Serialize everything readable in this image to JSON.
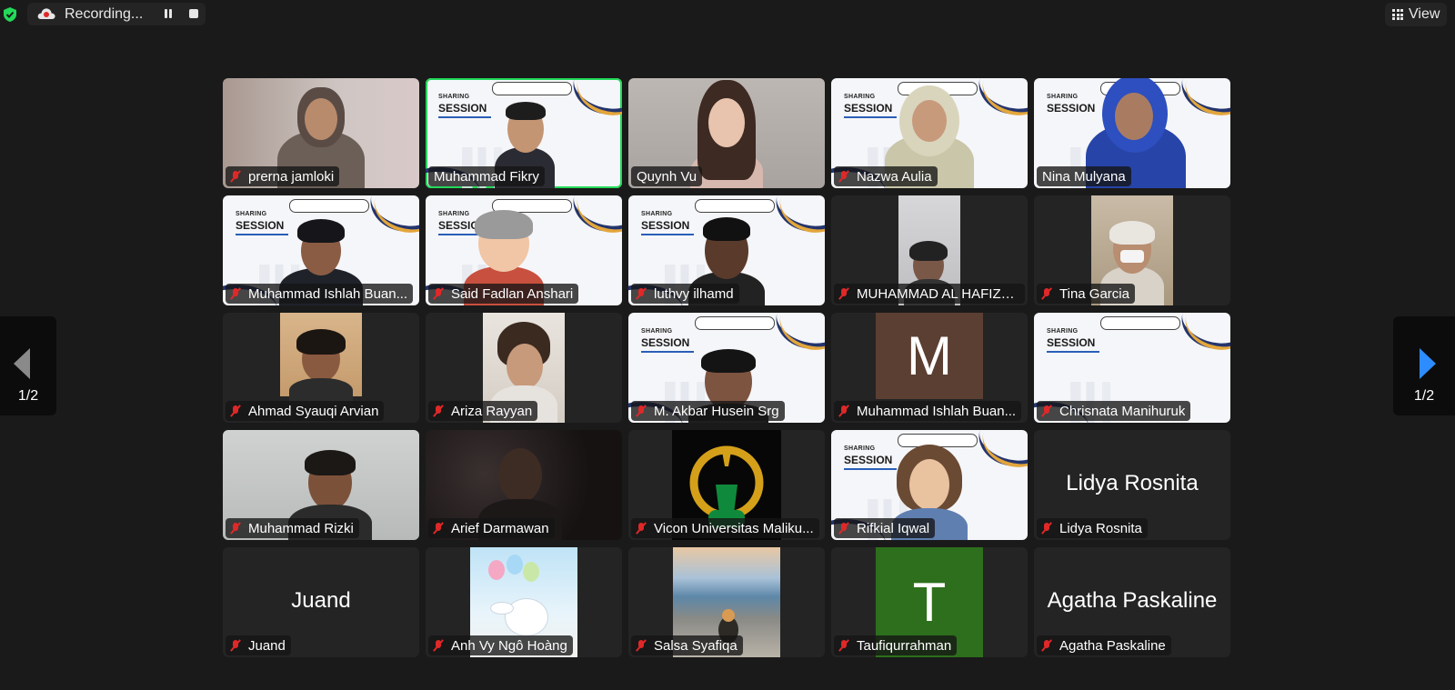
{
  "topbar": {
    "recording_label": "Recording...",
    "view_label": "View",
    "shield_color": "#23d959"
  },
  "pagination": {
    "left": "1/2",
    "right": "1/2"
  },
  "slide": {
    "small": "SHARING",
    "big": "SESSION"
  },
  "participants": [
    {
      "name": "prerna jamloki",
      "muted": true
    },
    {
      "name": "Muhammad Fikry",
      "muted": false,
      "active": true
    },
    {
      "name": "Quynh Vu",
      "muted": false
    },
    {
      "name": "Nazwa Aulia",
      "muted": true
    },
    {
      "name": "Nina Mulyana",
      "muted": false
    },
    {
      "name": "Muhammad Ishlah Buan...",
      "muted": true
    },
    {
      "name": "Said Fadlan Anshari",
      "muted": true
    },
    {
      "name": "luthvy ilhamd",
      "muted": true
    },
    {
      "name": "MUHAMMAD AL HAFIZ_...",
      "muted": true
    },
    {
      "name": "Tina Garcia",
      "muted": true
    },
    {
      "name": "Ahmad Syauqi Arvian",
      "muted": true
    },
    {
      "name": "Ariza Rayyan",
      "muted": true
    },
    {
      "name": "M. Akbar Husein Srg",
      "muted": true
    },
    {
      "name": "Muhammad Ishlah Buan...",
      "muted": true,
      "avatar_letter": "M"
    },
    {
      "name": "Chrisnata Manihuruk",
      "muted": true
    },
    {
      "name": "Muhammad Rizki",
      "muted": true
    },
    {
      "name": "Arief Darmawan",
      "muted": true
    },
    {
      "name": "Vicon Universitas Maliku...",
      "muted": true
    },
    {
      "name": "Rifkial Iqwal",
      "muted": true
    },
    {
      "name": "Lidya Rosnita",
      "muted": true,
      "display_name": "Lidya Rosnita"
    },
    {
      "name": "Juand",
      "muted": true,
      "display_name": "Juand"
    },
    {
      "name": "Anh Vy Ngô Hoàng",
      "muted": true
    },
    {
      "name": "Salsa Syafiqa",
      "muted": true
    },
    {
      "name": "Taufiqurrahman",
      "muted": true,
      "avatar_letter": "T"
    },
    {
      "name": "Agatha Paskaline",
      "muted": true,
      "display_name": "Agatha Paskaline"
    }
  ]
}
